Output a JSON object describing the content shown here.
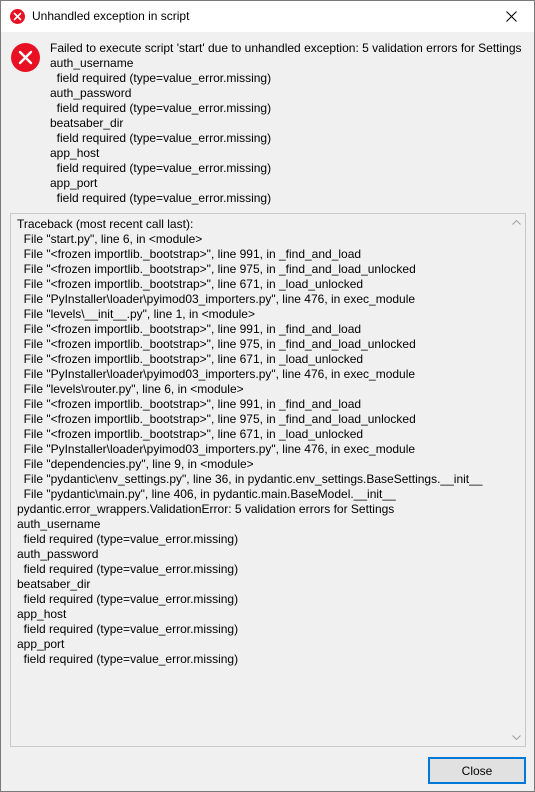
{
  "window": {
    "title": "Unhandled exception in script",
    "icon": "error-icon",
    "close_icon": "close-icon"
  },
  "message": {
    "lines": [
      "Failed to execute script 'start' due to unhandled exception: 5 validation errors for Settings",
      "auth_username",
      "  field required (type=value_error.missing)",
      "auth_password",
      "  field required (type=value_error.missing)",
      "beatsaber_dir",
      "  field required (type=value_error.missing)",
      "app_host",
      "  field required (type=value_error.missing)",
      "app_port",
      "  field required (type=value_error.missing)"
    ]
  },
  "traceback": {
    "lines": [
      "Traceback (most recent call last):",
      "  File \"start.py\", line 6, in <module>",
      "  File \"<frozen importlib._bootstrap>\", line 991, in _find_and_load",
      "  File \"<frozen importlib._bootstrap>\", line 975, in _find_and_load_unlocked",
      "  File \"<frozen importlib._bootstrap>\", line 671, in _load_unlocked",
      "  File \"PyInstaller\\loader\\pyimod03_importers.py\", line 476, in exec_module",
      "  File \"levels\\__init__.py\", line 1, in <module>",
      "  File \"<frozen importlib._bootstrap>\", line 991, in _find_and_load",
      "  File \"<frozen importlib._bootstrap>\", line 975, in _find_and_load_unlocked",
      "  File \"<frozen importlib._bootstrap>\", line 671, in _load_unlocked",
      "  File \"PyInstaller\\loader\\pyimod03_importers.py\", line 476, in exec_module",
      "  File \"levels\\router.py\", line 6, in <module>",
      "  File \"<frozen importlib._bootstrap>\", line 991, in _find_and_load",
      "  File \"<frozen importlib._bootstrap>\", line 975, in _find_and_load_unlocked",
      "  File \"<frozen importlib._bootstrap>\", line 671, in _load_unlocked",
      "  File \"PyInstaller\\loader\\pyimod03_importers.py\", line 476, in exec_module",
      "  File \"dependencies.py\", line 9, in <module>",
      "  File \"pydantic\\env_settings.py\", line 36, in pydantic.env_settings.BaseSettings.__init__",
      "  File \"pydantic\\main.py\", line 406, in pydantic.main.BaseModel.__init__",
      "pydantic.error_wrappers.ValidationError: 5 validation errors for Settings",
      "auth_username",
      "  field required (type=value_error.missing)",
      "auth_password",
      "  field required (type=value_error.missing)",
      "beatsaber_dir",
      "  field required (type=value_error.missing)",
      "app_host",
      "  field required (type=value_error.missing)",
      "app_port",
      "  field required (type=value_error.missing)"
    ],
    "scroll_up_icon": "scroll-up-arrow-icon",
    "scroll_down_icon": "scroll-down-arrow-icon"
  },
  "buttons": {
    "close_label": "Close"
  },
  "colors": {
    "error_red": "#e81123",
    "focus_blue": "#0078d7",
    "dialog_bg": "#f0f0f0"
  }
}
